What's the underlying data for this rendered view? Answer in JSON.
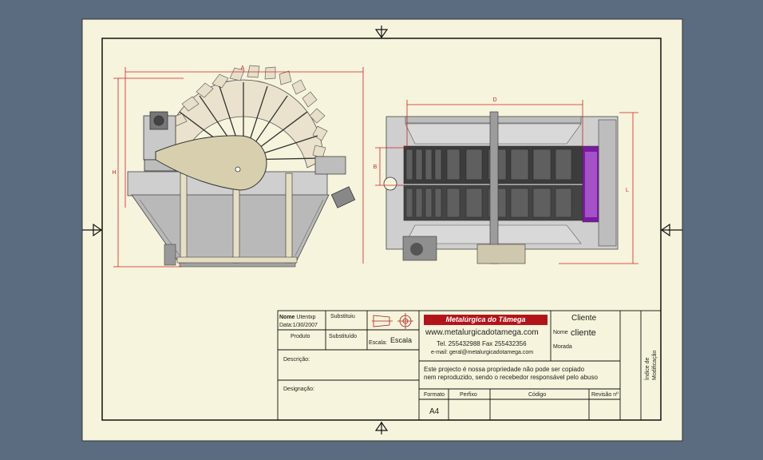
{
  "drawing": {
    "dimensions": {
      "a": "A",
      "h": "H",
      "d": "D",
      "b": "B",
      "l": "L"
    }
  },
  "title_block": {
    "nome_label": "Nome",
    "nome_value": "Utentxp",
    "data_label": "Data:",
    "data_value": "1/30/2007",
    "substituiu": "Substituiu",
    "produto": "Produto",
    "substituido": "Substituído",
    "escala_label": "Escala:",
    "escala_value": "Escala",
    "descricao": "Descrição:",
    "designacao": "Designação:",
    "company_name": "Metalúrgica do Tâmega",
    "website": "www.metalurgicadotamega.com",
    "phone": "Tel. 255432988 Fax 255432356",
    "email": "e-mail: geral@metalurgicadotamega.com",
    "cliente_title": "Cliente",
    "nome_cliente_label": "Nome",
    "nome_cliente_value": "cliente",
    "morada": "Morada",
    "notice_line1": "Este projecto é nossa propriedade não pode ser copiado",
    "notice_line2": "nem reproduzido, sendo o recebedor responsável pelo abuso",
    "formato_label": "Formato",
    "formato_value": "A4",
    "perfixo": "Perfixo",
    "codigo": "Código",
    "revisao": "Revisão nº",
    "indice_line1": "Índice de",
    "indice_line2": "Modificação"
  },
  "colors": {
    "sheet": "#f6f4dc",
    "background": "#5b6b80",
    "dim_red": "#d42020",
    "accent_purple": "#7a1aa0"
  }
}
